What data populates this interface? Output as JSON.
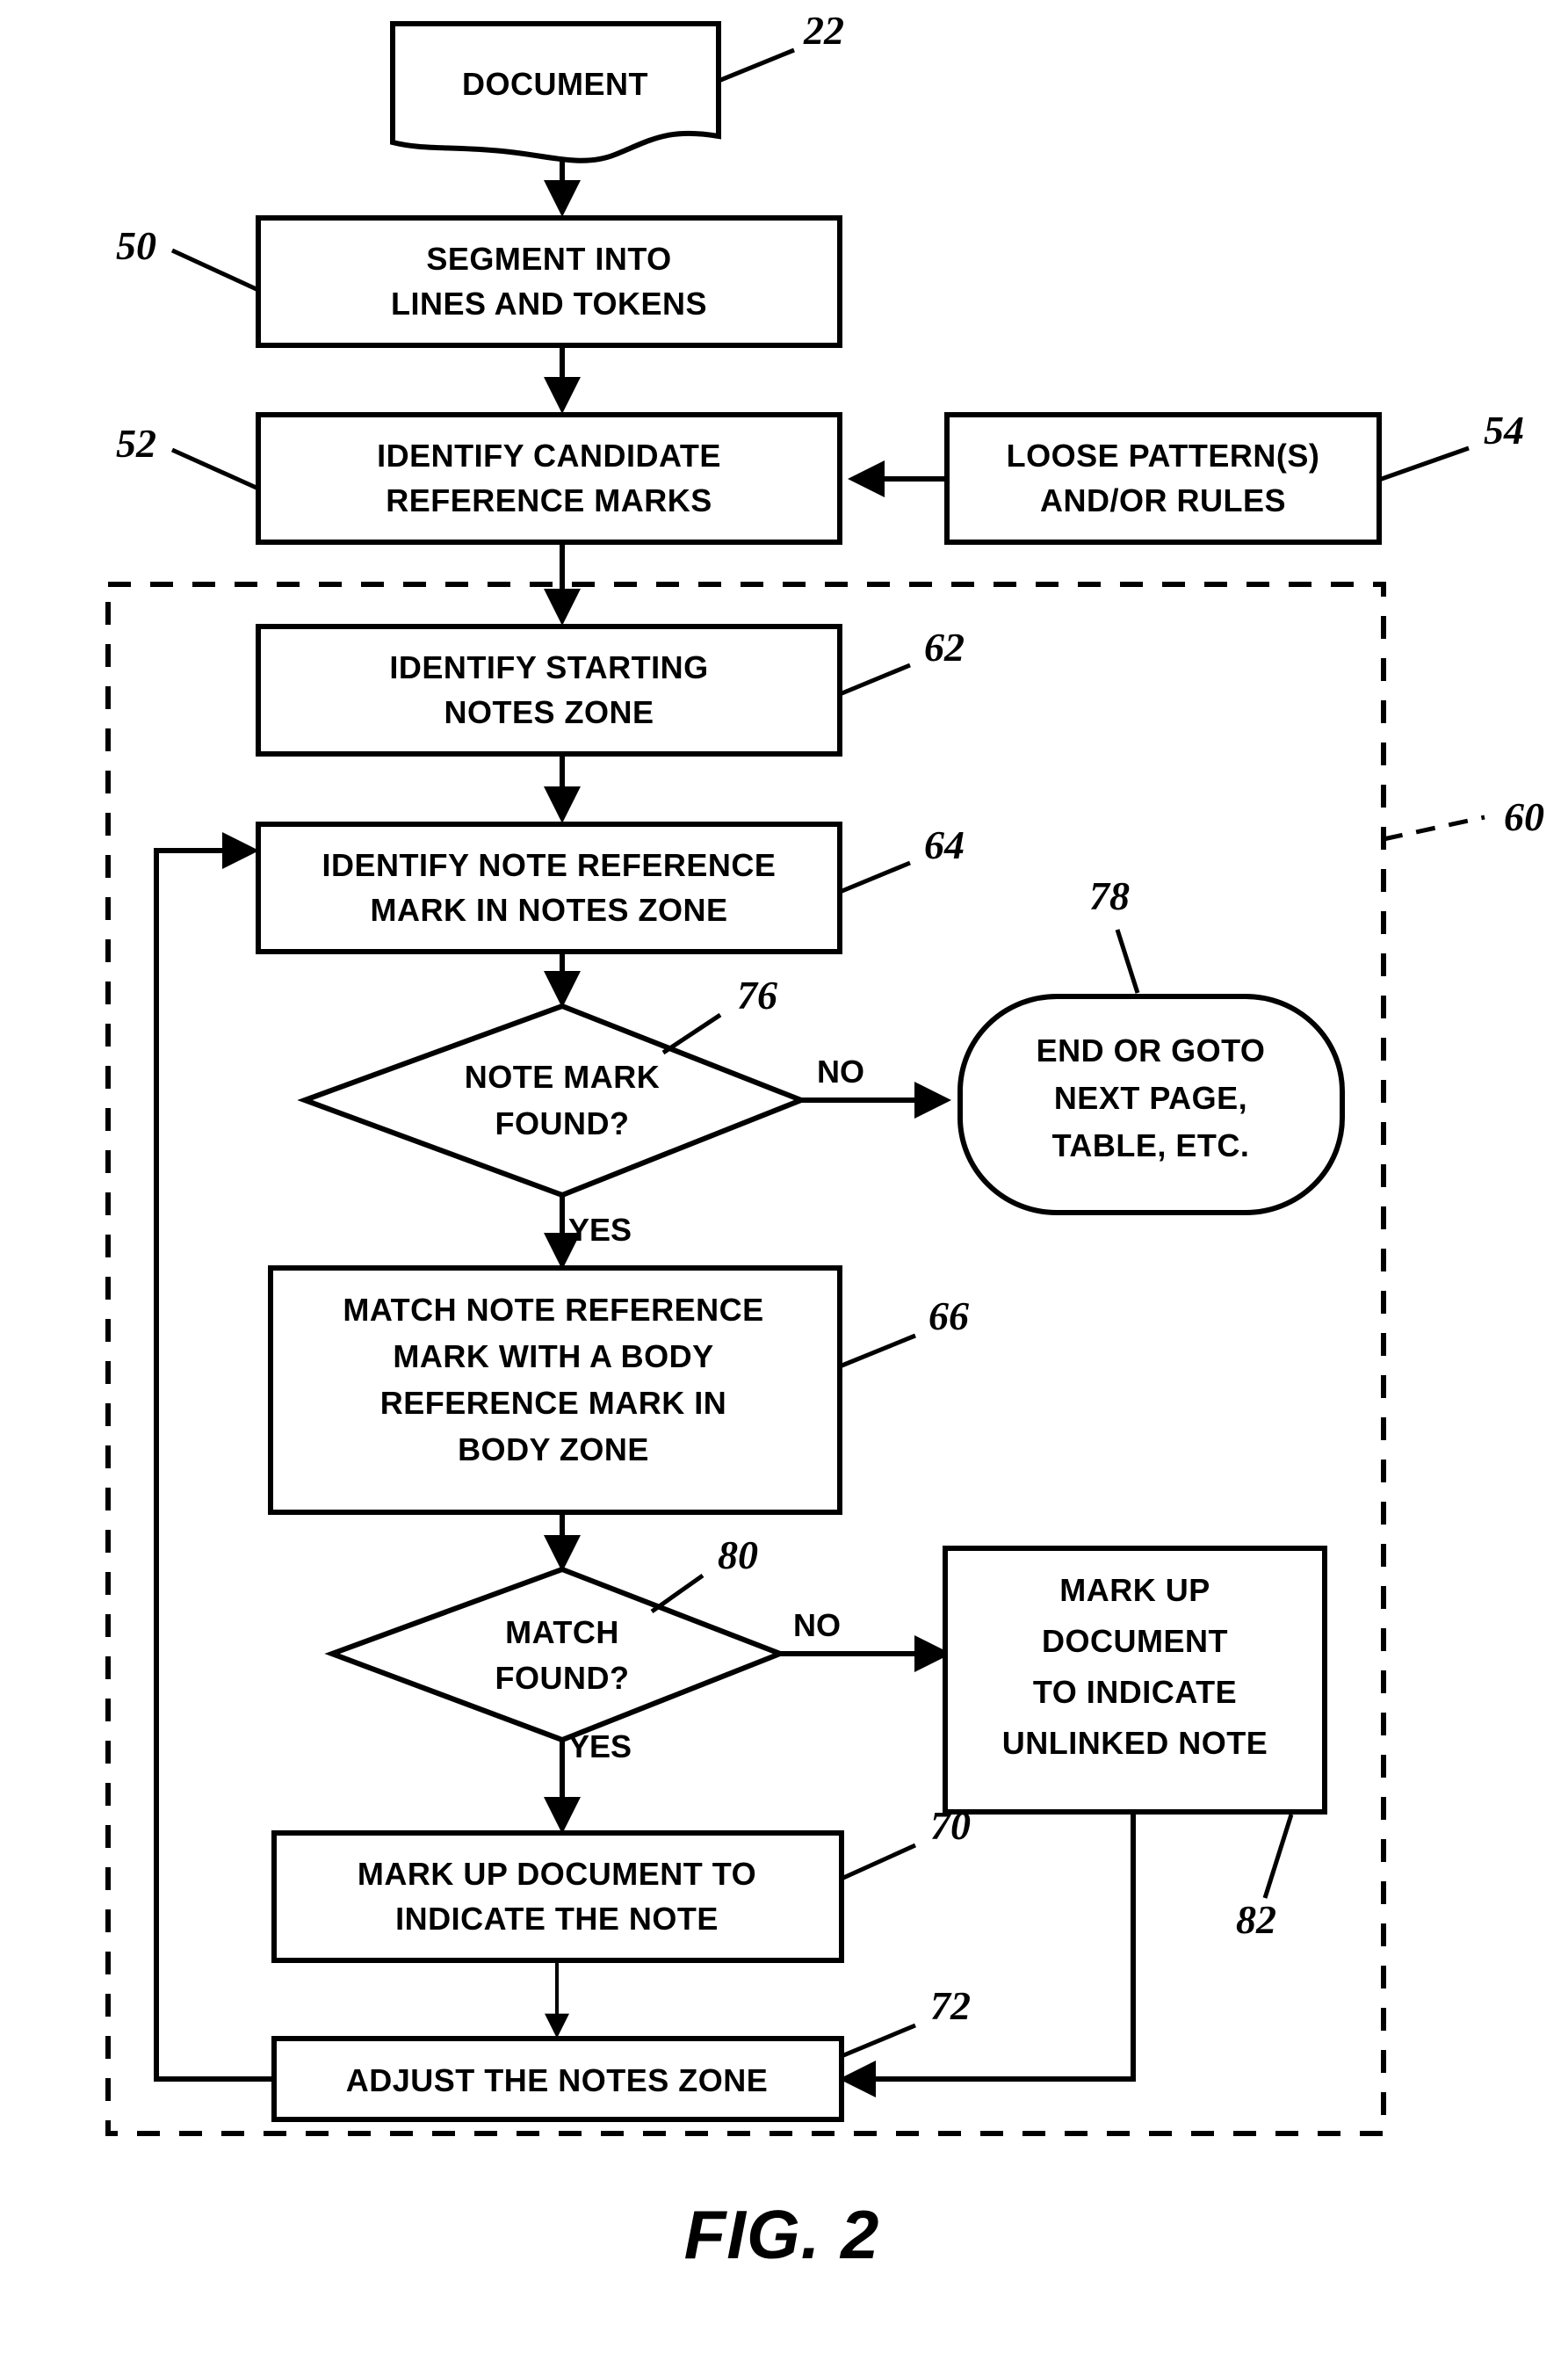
{
  "figure": {
    "caption": "FIG. 2",
    "type": "flowchart",
    "background_color": "#ffffff",
    "line_color": "#000000"
  },
  "nodes": {
    "document": {
      "shape": "document",
      "label_lines": [
        "DOCUMENT"
      ],
      "ref": "22"
    },
    "segment": {
      "shape": "rect",
      "label_lines": [
        "SEGMENT INTO",
        "LINES AND TOKENS"
      ],
      "ref": "50"
    },
    "identify_candidate": {
      "shape": "rect",
      "label_lines": [
        "IDENTIFY CANDIDATE",
        "REFERENCE MARKS"
      ],
      "ref": "52"
    },
    "loose_patterns": {
      "shape": "rect",
      "label_lines": [
        "LOOSE PATTERN(S)",
        "AND/OR RULES"
      ],
      "ref": "54"
    },
    "identify_starting_zone": {
      "shape": "rect",
      "label_lines": [
        "IDENTIFY STARTING",
        "NOTES ZONE"
      ],
      "ref": "62"
    },
    "identify_note_mark": {
      "shape": "rect",
      "label_lines": [
        "IDENTIFY NOTE REFERENCE",
        "MARK IN NOTES ZONE"
      ],
      "ref": "64"
    },
    "note_mark_found": {
      "shape": "diamond",
      "label_lines": [
        "NOTE MARK",
        "FOUND?"
      ],
      "ref": "76"
    },
    "end_or_goto": {
      "shape": "rounded",
      "label_lines": [
        "END OR GOTO",
        "NEXT PAGE,",
        "TABLE, ETC."
      ],
      "ref": "78"
    },
    "match_note_mark": {
      "shape": "rect",
      "label_lines": [
        "MATCH NOTE REFERENCE",
        "MARK WITH A BODY",
        "REFERENCE MARK IN",
        "BODY ZONE"
      ],
      "ref": "66"
    },
    "match_found": {
      "shape": "diamond",
      "label_lines": [
        "MATCH",
        "FOUND?"
      ],
      "ref": "80"
    },
    "markup_unlinked": {
      "shape": "rect",
      "label_lines": [
        "MARK UP",
        "DOCUMENT",
        "TO INDICATE",
        "UNLINKED NOTE"
      ],
      "ref": "82"
    },
    "markup_note": {
      "shape": "rect",
      "label_lines": [
        "MARK UP DOCUMENT TO",
        "INDICATE THE NOTE"
      ],
      "ref": "70"
    },
    "adjust_notes_zone": {
      "shape": "rect",
      "label_lines": [
        "ADJUST THE NOTES ZONE"
      ],
      "ref": "72"
    },
    "process_group": {
      "shape": "dashed-rect",
      "ref": "60"
    }
  },
  "edge_labels": {
    "note_mark_no": "NO",
    "note_mark_yes": "YES",
    "match_no": "NO",
    "match_yes": "YES"
  }
}
